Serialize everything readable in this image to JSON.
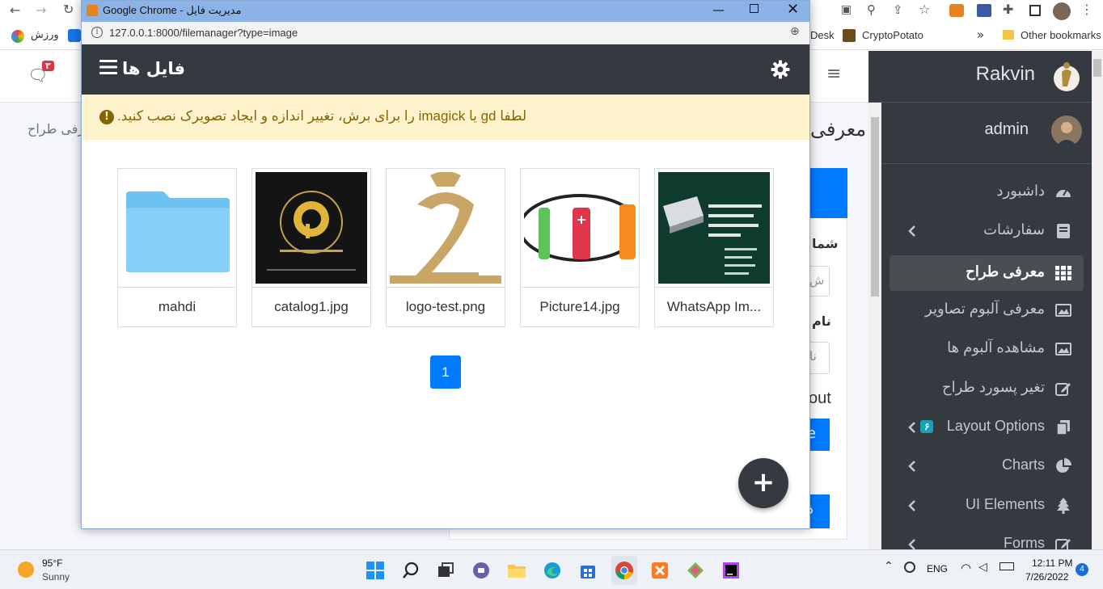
{
  "browser": {
    "bookmarks": {
      "varzesh": "ورزش",
      "desk": "Desk",
      "cryptopotato": "CryptoPotato",
      "more": "»",
      "other": "Other bookmarks"
    }
  },
  "bg_page": {
    "notif_count": "۳",
    "breadcrumb": "معرفی طراح",
    "heading": "معرفی",
    "label1": "شما",
    "label2": "نام",
    "input1": "ش",
    "input2": "نا",
    "out_text": "out",
    "btn_e": "e",
    "btn_z": "ذ"
  },
  "sidebar": {
    "brand": "Rakvin",
    "user": "admin",
    "items": [
      {
        "label": "داشبورد",
        "icon": "dashboard-icon"
      },
      {
        "label": "سفارشات",
        "icon": "book-icon"
      },
      {
        "label": "معرفی طراح",
        "icon": "grid-icon"
      },
      {
        "label": "معرفی آلبوم تصاویر",
        "icon": "image-icon"
      },
      {
        "label": "مشاهده آلبوم ها",
        "icon": "image-icon"
      },
      {
        "label": "تغیر پسورد طراح",
        "icon": "edit-icon"
      },
      {
        "label": "Layout Options",
        "badge": "۶",
        "icon": "copy-icon"
      },
      {
        "label": "Charts",
        "icon": "pie-chart-icon"
      },
      {
        "label": "UI Elements",
        "icon": "tree-icon"
      },
      {
        "label": "Forms",
        "icon": "edit-icon"
      }
    ]
  },
  "popup": {
    "window_title": "Google Chrome - مدیریت فایل",
    "url": "127.0.0.1:8000/filemanager?type=image",
    "nav_title": "فایل ها",
    "alert": ".را برای برش، تغییر اندازه و ایجاد تصویرک نصب کنید imagick یا gd لطفا",
    "files": [
      {
        "name": "mahdi",
        "type": "folder"
      },
      {
        "name": "catalog1.jpg",
        "type": "image"
      },
      {
        "name": "logo-test.png",
        "type": "image"
      },
      {
        "name": "Picture14.jpg",
        "type": "image"
      },
      {
        "name": "WhatsApp Im...",
        "type": "image"
      }
    ],
    "page": "1",
    "fab": "+"
  },
  "taskbar": {
    "temp": "95°F",
    "weather": "Sunny",
    "lang": "ENG",
    "time": "12:11 PM",
    "date": "7/26/2022",
    "notif": "4"
  },
  "colors": {
    "primary": "#007bff",
    "dark": "#343a40",
    "alert_bg": "#fff3cd",
    "alert_text": "#856404",
    "titlebar": "#8bb3e8"
  }
}
